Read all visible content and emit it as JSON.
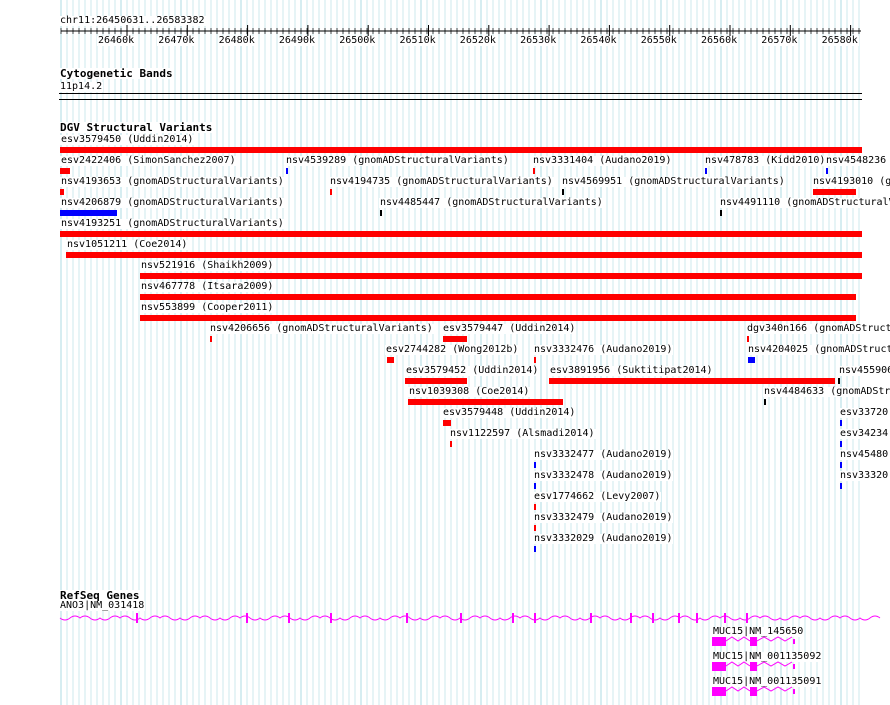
{
  "ruler": {
    "region": "chr11:26450631..26583382",
    "ticks": [
      "26460k",
      "26470k",
      "26480k",
      "26490k",
      "26500k",
      "26510k",
      "26520k",
      "26530k",
      "26540k",
      "26550k",
      "26560k",
      "26570k",
      "26580k"
    ]
  },
  "tracks": {
    "cyto": {
      "title": "Cytogenetic Bands",
      "band": "11p14.2"
    },
    "dgv": {
      "title": "DGV Structural Variants"
    },
    "refseq": {
      "title": "RefSeq Genes"
    }
  },
  "colors": {
    "loss": "#ff0000",
    "gain": "#0000ff",
    "gene": "#ff00ff",
    "grid": "#aedbe3"
  },
  "variants": [
    {
      "id": "esv3579450 (Uddin2014)",
      "c": "loss"
    },
    {
      "id": "esv2422406 (SimonSanchez2007)",
      "c": "loss"
    },
    {
      "id": "nsv4539289 (gnomADStructuralVariants)",
      "c": "gain"
    },
    {
      "id": "nsv3331404 (Audano2019)",
      "c": "loss"
    },
    {
      "id": "nsv478783 (Kidd2010)",
      "c": "gain"
    },
    {
      "id": "nsv4548236",
      "c": "gain"
    },
    {
      "id": "nsv4193653 (gnomADStructuralVariants)",
      "c": "loss"
    },
    {
      "id": "nsv4194735 (gnomADStructuralVariants)",
      "c": "loss"
    },
    {
      "id": "nsv4569951 (gnomADStructuralVariants)",
      "c": "black"
    },
    {
      "id": "nsv4193010 (gn",
      "c": "loss"
    },
    {
      "id": "nsv4206879 (gnomADStructuralVariants)",
      "c": "gain"
    },
    {
      "id": "nsv4485447 (gnomADStructuralVariants)",
      "c": "black"
    },
    {
      "id": "nsv4491110 (gnomADStructuralV",
      "c": "black"
    },
    {
      "id": "nsv4193251 (gnomADStructuralVariants)",
      "c": "loss"
    },
    {
      "id": "nsv1051211 (Coe2014)",
      "c": "loss"
    },
    {
      "id": "nsv521916 (Shaikh2009)",
      "c": "loss"
    },
    {
      "id": "nsv467778 (Itsara2009)",
      "c": "loss"
    },
    {
      "id": "nsv553899 (Cooper2011)",
      "c": "loss"
    },
    {
      "id": "nsv4206656 (gnomADStructuralVariants)",
      "c": "loss"
    },
    {
      "id": "esv3579447 (Uddin2014)",
      "c": "loss"
    },
    {
      "id": "dgv340n166 (gnomADStruct",
      "c": "loss"
    },
    {
      "id": "esv2744282 (Wong2012b)",
      "c": "loss"
    },
    {
      "id": "nsv3332476 (Audano2019)",
      "c": "loss"
    },
    {
      "id": "nsv4204025 (gnomADStruct",
      "c": "gain"
    },
    {
      "id": "esv3579452 (Uddin2014)",
      "c": "loss"
    },
    {
      "id": "esv3891956 (Suktitipat2014)",
      "c": "loss"
    },
    {
      "id": "nsv455906",
      "c": "black"
    },
    {
      "id": "nsv1039308 (Coe2014)",
      "c": "loss"
    },
    {
      "id": "nsv4484633 (gnomADStr",
      "c": "black"
    },
    {
      "id": "esv3579448 (Uddin2014)",
      "c": "loss"
    },
    {
      "id": "esv33720",
      "c": "gain"
    },
    {
      "id": "nsv1122597 (Alsmadi2014)",
      "c": "loss"
    },
    {
      "id": "esv34234",
      "c": "gain"
    },
    {
      "id": "nsv3332477 (Audano2019)",
      "c": "gain"
    },
    {
      "id": "nsv45480",
      "c": "gain"
    },
    {
      "id": "nsv3332478 (Audano2019)",
      "c": "gain"
    },
    {
      "id": "nsv33320",
      "c": "gain"
    },
    {
      "id": "esv1774662 (Levy2007)",
      "c": "loss"
    },
    {
      "id": "nsv3332479 (Audano2019)",
      "c": "loss"
    },
    {
      "id": "nsv3332029 (Audano2019)",
      "c": "gain"
    }
  ],
  "genes": [
    {
      "label": "ANO3|NM_031418"
    },
    {
      "label": "MUC15|NM_145650"
    },
    {
      "label": "MUC15|NM_001135092"
    },
    {
      "label": "MUC15|NM_001135091"
    }
  ]
}
